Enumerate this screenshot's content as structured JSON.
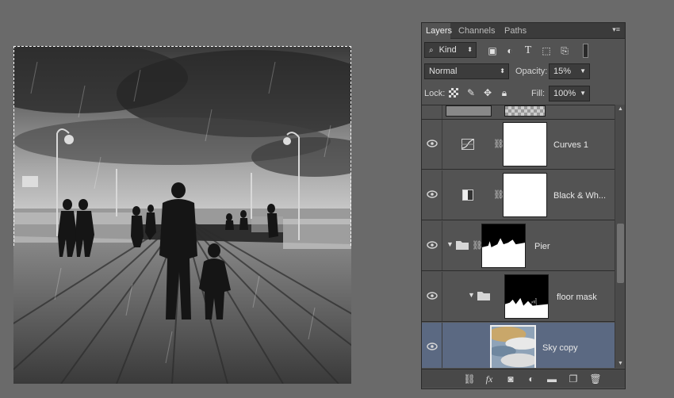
{
  "tabs": [
    {
      "label": "Layers",
      "active": true
    },
    {
      "label": "Channels",
      "active": false
    },
    {
      "label": "Paths",
      "active": false
    }
  ],
  "panel_menu_glyph": "▾≡",
  "filter": {
    "label": "Kind",
    "icon": "search-icon"
  },
  "filter_icons": [
    "image-filter-icon",
    "adjustment-filter-icon",
    "type-filter-icon",
    "shape-filter-icon",
    "smart-object-filter-icon",
    "filter-toggle-icon"
  ],
  "blend_mode": "Normal",
  "opacity": {
    "label": "Opacity:",
    "value": "15%"
  },
  "lock": {
    "label": "Lock:"
  },
  "lock_icons": [
    "lock-transparent-icon",
    "lock-image-icon",
    "lock-position-icon",
    "lock-all-icon"
  ],
  "fill": {
    "label": "Fill:",
    "value": "100%"
  },
  "layers": [
    {
      "name": "Curves 1",
      "type": "adjustment",
      "icon": "curves-icon",
      "selected": false
    },
    {
      "name": "Black & Wh...",
      "type": "adjustment",
      "icon": "black-white-icon",
      "selected": false
    },
    {
      "name": "Pier",
      "type": "group",
      "expanded": true,
      "selected": false
    },
    {
      "name": "floor mask",
      "type": "group",
      "expanded": true,
      "selected": false
    },
    {
      "name": "Sky copy",
      "type": "image",
      "selected": true
    }
  ],
  "bottom_icons": [
    "link-layers-icon",
    "fx-icon",
    "add-mask-icon",
    "new-adjustment-icon",
    "new-group-icon",
    "new-layer-icon",
    "delete-icon"
  ],
  "colors": {
    "selected_row": "#5b6982",
    "panel_bg": "#535353",
    "canvas_bg": "#6a6a6a"
  }
}
